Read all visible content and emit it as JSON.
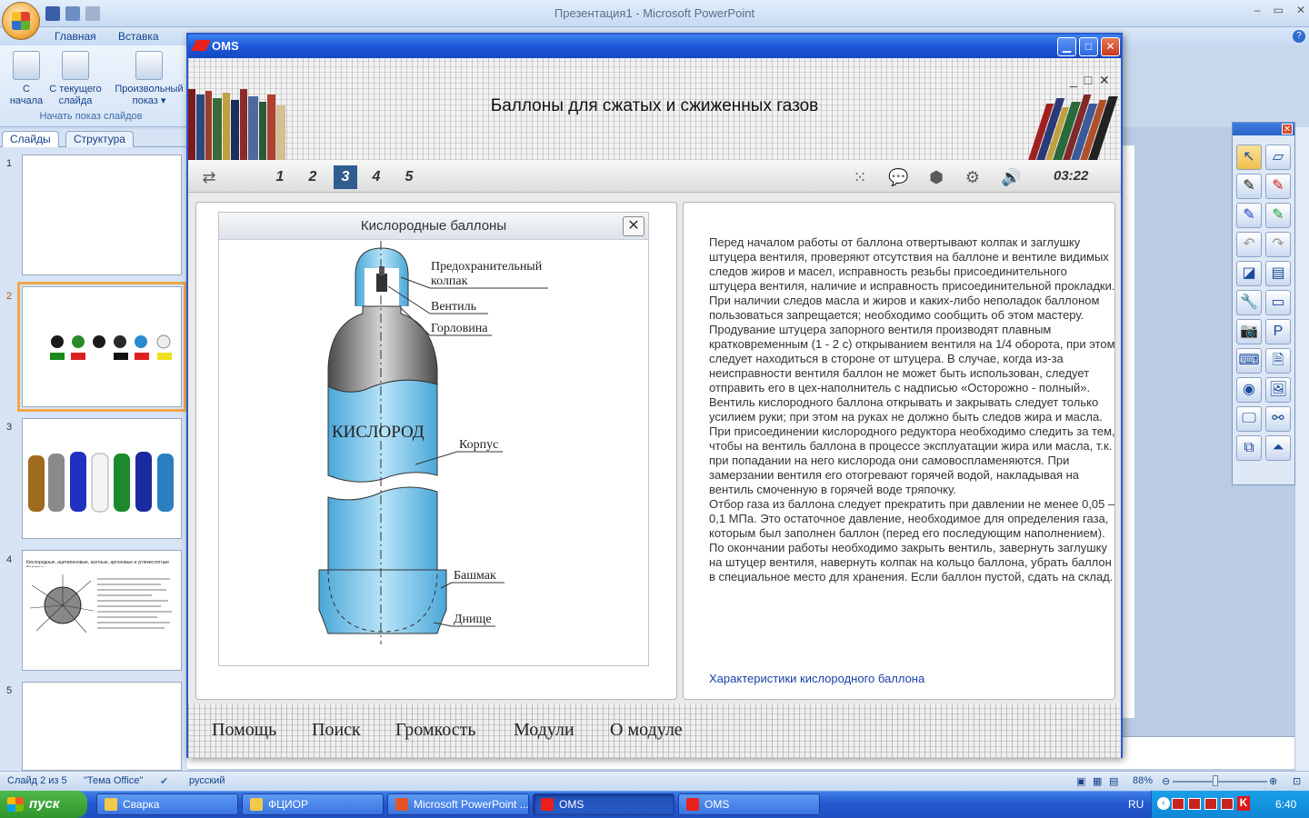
{
  "powerpoint": {
    "window_title": "Презентация1 - Microsoft PowerPoint",
    "tabs": [
      "Главная",
      "Вставка"
    ],
    "ribbon_buttons": [
      {
        "label_line1": "С",
        "label_line2": "начала"
      },
      {
        "label_line1": "С текущего",
        "label_line2": "слайда"
      },
      {
        "label_line1": "Произвольный",
        "label_line2": "показ ▾"
      }
    ],
    "group_label": "Начать показ слайдов",
    "pane_tabs": [
      "Слайды",
      "Структура"
    ],
    "slide_numbers": [
      "1",
      "2",
      "3",
      "4",
      "5"
    ],
    "slide4_title": "Кислородные, ацетиленовые, азотные, аргоновые и углекислотные баллоны"
  },
  "status": {
    "slide": "Слайд 2 из 5",
    "theme": "\"Тема Office\"",
    "language": "русский",
    "zoom": "88%"
  },
  "taskbar": {
    "start": "пуск",
    "tasks": [
      "Сварка",
      "ФЦИОР",
      "Microsoft PowerPoint ...",
      "OMS",
      "OMS"
    ],
    "lang": "RU",
    "clock": "6:40"
  },
  "oms": {
    "window_title": "OMS",
    "header_title": "Баллоны для сжатых и сжиженных газов",
    "pages": [
      "1",
      "2",
      "3",
      "4",
      "5"
    ],
    "active_page": "3",
    "timer": "03:22",
    "image_title": "Кислородные баллоны",
    "diagram": {
      "cap": "Предохранительный колпак",
      "valve": "Вентиль",
      "neck": "Горловина",
      "body": "Корпус",
      "gas": "КИСЛОРОД",
      "shoe": "Башмак",
      "bottom": "Днище"
    },
    "paragraphs": [
      "Перед началом работы от баллона отвертывают колпак и заглушку штуцера вентиля, проверяют отсутствия на баллоне и вентиле видимых следов жиров и масел, исправность резьбы присоединительного штуцера вентиля, наличие и исправность присоединительной прокладки. При наличии следов масла и жиров и каких-либо неполадок баллоном пользоваться запрещается; необходимо сообщить об этом мастеру.",
      "Продувание штуцера запорного вентиля производят плавным кратковременным (1 - 2 с) открыванием вентиля на 1/4 оборота, при этом следует находиться в стороне от штуцера. В случае, когда из-за неисправности вентиля баллон не может быть использован, следует отправить его в цех-наполнитель с надписью «Осторожно - полный».",
      "Вентиль кислородного баллона открывать и закрывать следует только усилием руки; при этом на руках не должно быть следов жира и масла. При присоединении кислородного редуктора необходимо следить за тем, чтобы на вентиль баллона в процессе эксплуатации жира или масла, т.к. при попадании на него кислорода они самовоспламеняются. При замерзании вентиля его отогревают горячей водой, накладывая на вентиль смоченную в горячей воде тряпочку.",
      "Отбор газа из баллона следует прекратить при давлении не менее 0,05 – 0,1 МПа. Это остаточное давление, необходимое для определения газа, которым был заполнен баллон (перед его последующим наполнением).",
      "По окончании работы необходимо закрыть вентиль, завернуть заглушку на штуцер вентиля, навернуть колпак на кольцо баллона, убрать баллон в специальное место для хранения. Если баллон пустой, сдать на склад."
    ],
    "link": "Характеристики кислородного баллона",
    "footer_menu": [
      "Помощь",
      "Поиск",
      "Громкость",
      "Модули",
      "О модуле"
    ]
  },
  "colors": {
    "accent": "#2f5d8e",
    "xp_blue": "#2458d0",
    "ribbon": "#15428b"
  }
}
